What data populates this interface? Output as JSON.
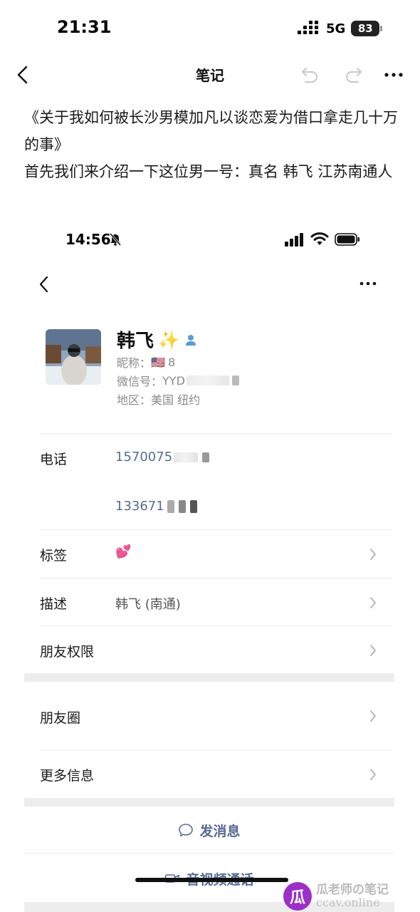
{
  "status_bar": {
    "time": "21:31",
    "network": "5G",
    "battery": "83"
  },
  "nav": {
    "title": "笔记"
  },
  "note": {
    "line1": "《关于我如何被长沙男模加凡以谈恋爱为借口拿走几十万的事》",
    "line2": "首先我们来介绍一下这位男一号：真名 韩飞 江苏南通人"
  },
  "embedded": {
    "status_bar": {
      "time": "14:56"
    },
    "profile": {
      "name": "韩飞",
      "name_emoji": "✨",
      "nickname_label": "昵称：",
      "nickname_flag": "🇺🇸",
      "nickname_value": "8",
      "wechat_label": "微信号：",
      "wechat_value": "YYD",
      "region_label": "地区：",
      "region_value": "美国 纽约"
    },
    "rows": {
      "phone_label": "电话",
      "phone1": "1570075",
      "phone2": "133671",
      "tag_label": "标签",
      "tag_value": "💕",
      "desc_label": "描述",
      "desc_value": "韩飞 (南通)",
      "permission_label": "朋友权限",
      "moments_label": "朋友圈",
      "more_info_label": "更多信息"
    },
    "actions": {
      "message": "发消息",
      "video_call": "音视频通话"
    }
  },
  "watermark": {
    "logo": "瓜",
    "line1": "瓜老师の笔记",
    "line2": "ccav.online"
  },
  "colors": {
    "link_blue": "#576b95",
    "divider": "#ececec",
    "watermark_purple": "#9b2fc8"
  }
}
